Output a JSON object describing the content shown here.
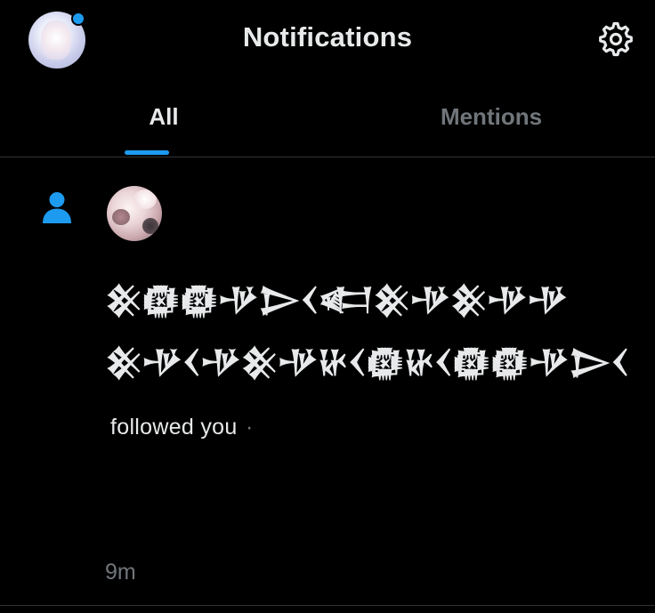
{
  "header": {
    "title": "Notifications",
    "avatar_icon": "profile-avatar",
    "settings_icon": "gear-icon",
    "accent_color": "#1d9bf0"
  },
  "tabs": [
    {
      "label": "All",
      "selected": true
    },
    {
      "label": "Mentions",
      "selected": false
    }
  ],
  "notification": {
    "type_icon": "person-icon",
    "actor_name": "𒆜𒁈𒁈𒋩𒆕𒌋𒅗𒆜𒋩𒆜𒋩𒋩𒆜𒋩𒌋𒋩𒆜𒋩𒄩𒌋𒁈𒄩𒌋𒁈𒁈𒋩𒆕𒌋",
    "action": "followed you",
    "separator": "·",
    "time": "9m"
  },
  "colors": {
    "background": "#000000",
    "primary_text": "#e7e9ea",
    "secondary_text": "#71767b",
    "divider": "#2f3336"
  }
}
